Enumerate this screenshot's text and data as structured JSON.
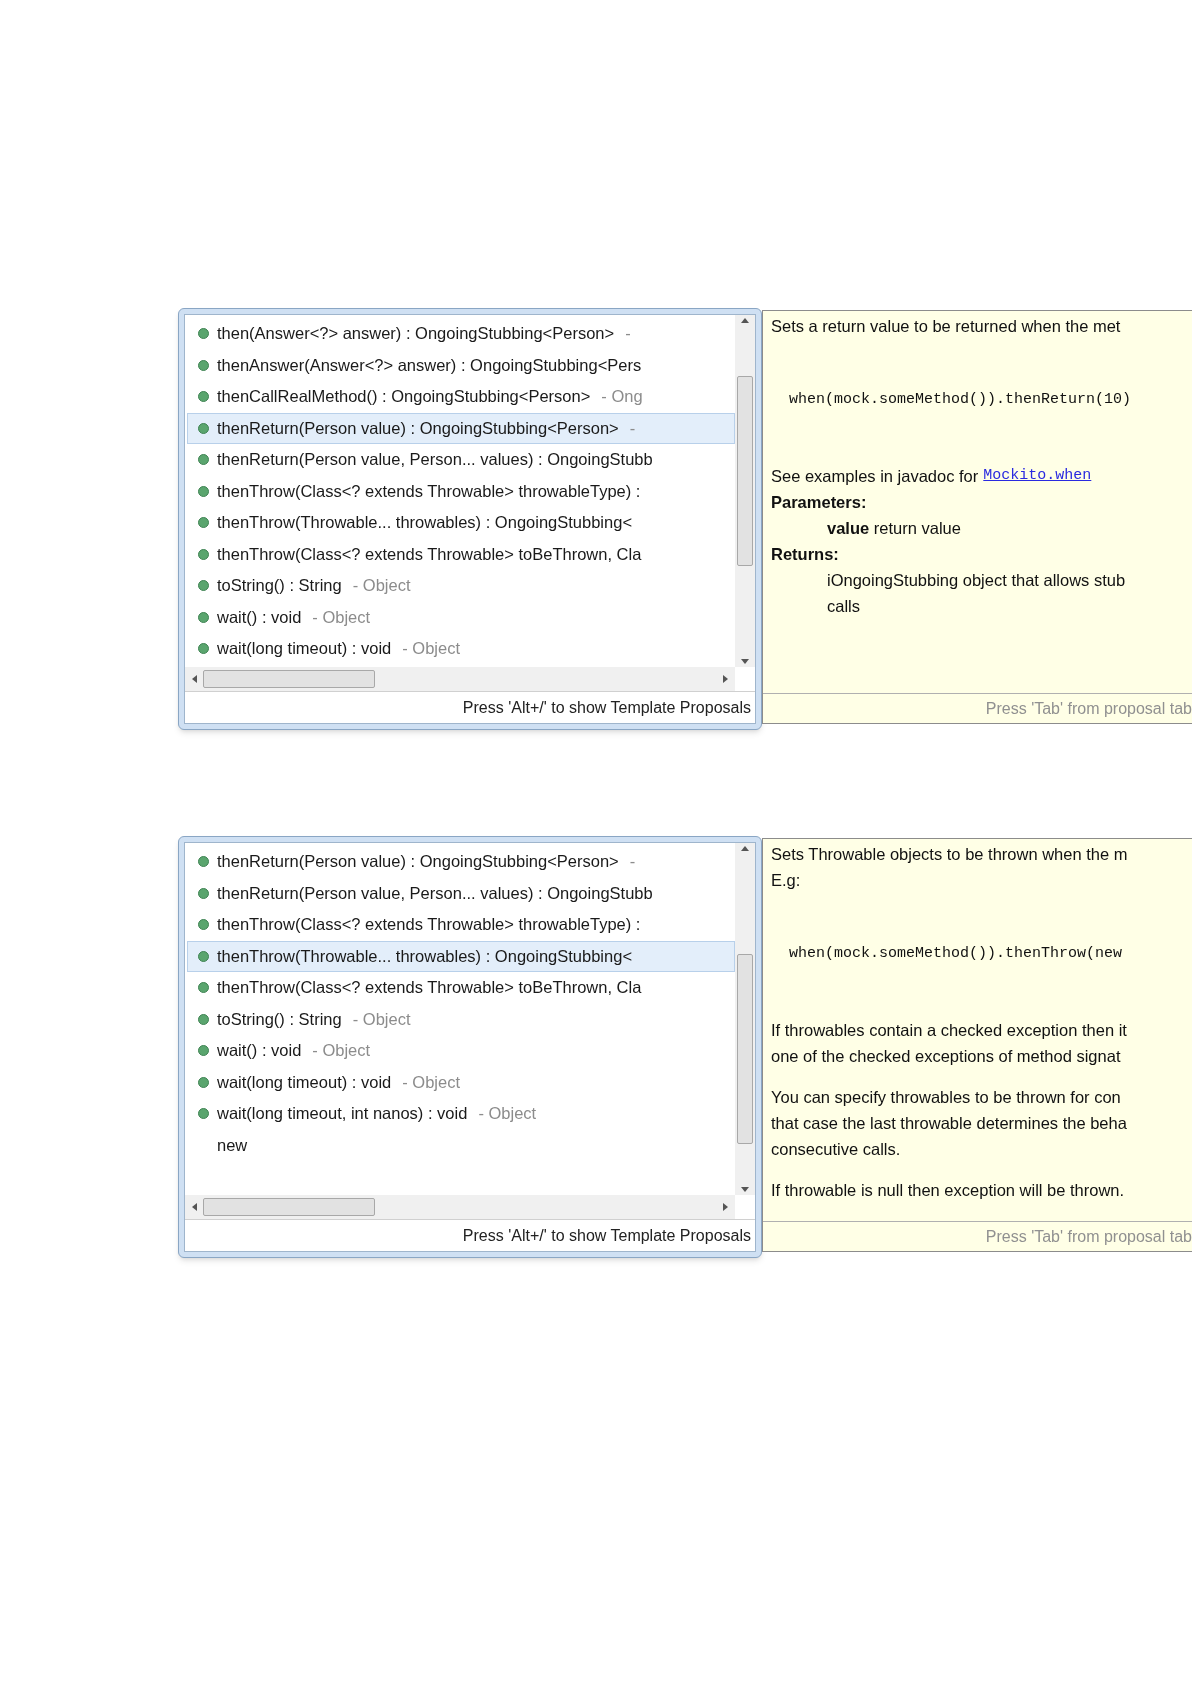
{
  "figures": [
    {
      "proposals": {
        "items": [
          {
            "kind": "method",
            "signature": "then(Answer<?> answer) : OngoingStubbing<Person>",
            "owner": "-",
            "selected": false
          },
          {
            "kind": "method",
            "signature": "thenAnswer(Answer<?> answer) : OngoingStubbing<Pers",
            "selected": false
          },
          {
            "kind": "method",
            "signature": "thenCallRealMethod() : OngoingStubbing<Person>",
            "owner": "- Ong",
            "selected": false
          },
          {
            "kind": "method",
            "signature": "thenReturn(Person value) : OngoingStubbing<Person>",
            "owner": "-",
            "selected": true
          },
          {
            "kind": "method",
            "signature": "thenReturn(Person value, Person... values) : OngoingStubb",
            "selected": false
          },
          {
            "kind": "method",
            "signature": "thenThrow(Class<? extends Throwable> throwableType) :",
            "selected": false
          },
          {
            "kind": "method",
            "signature": "thenThrow(Throwable... throwables) : OngoingStubbing<",
            "selected": false
          },
          {
            "kind": "method",
            "signature": "thenThrow(Class<? extends Throwable> toBeThrown, Cla",
            "selected": false
          },
          {
            "kind": "method",
            "signature": "toString() : String",
            "owner": "- Object",
            "selected": false
          },
          {
            "kind": "method",
            "signature": "wait() : void",
            "owner": "- Object",
            "selected": false
          },
          {
            "kind": "method",
            "signature": "wait(long timeout) : void",
            "owner": "- Object",
            "selected": false
          }
        ],
        "hint": "Press 'Alt+/' to show Template Proposals"
      },
      "doc": {
        "blocks": [
          {
            "kind": "text",
            "lines": [
              "Sets a return value to be returned when the met"
            ]
          },
          {
            "kind": "code",
            "text": "when(mock.someMethod()).thenReturn(10)"
          },
          {
            "kind": "link_text",
            "text": "See examples in javadoc for",
            "link": "Mockito.when"
          },
          {
            "kind": "heading",
            "text": "Parameters:"
          },
          {
            "kind": "indent",
            "lines": [
              "**value** return value"
            ]
          },
          {
            "kind": "heading",
            "text": "Returns:"
          },
          {
            "kind": "indent",
            "lines": [
              "iOngoingStubbing object that allows stub",
              "calls"
            ]
          }
        ],
        "footer": "Press 'Tab' from proposal tab"
      }
    },
    {
      "proposals": {
        "items": [
          {
            "kind": "method",
            "signature": "thenReturn(Person value) : OngoingStubbing<Person>",
            "owner": "-",
            "selected": false
          },
          {
            "kind": "method",
            "signature": "thenReturn(Person value, Person... values) : OngoingStubb",
            "selected": false
          },
          {
            "kind": "method",
            "signature": "thenThrow(Class<? extends Throwable> throwableType) :",
            "selected": false
          },
          {
            "kind": "method",
            "signature": "thenThrow(Throwable... throwables) : OngoingStubbing<",
            "selected": true
          },
          {
            "kind": "method",
            "signature": "thenThrow(Class<? extends Throwable> toBeThrown, Cla",
            "selected": false
          },
          {
            "kind": "method",
            "signature": "toString() : String",
            "owner": "- Object",
            "selected": false
          },
          {
            "kind": "method",
            "signature": "wait() : void",
            "owner": "- Object",
            "selected": false
          },
          {
            "kind": "method",
            "signature": "wait(long timeout) : void",
            "owner": "- Object",
            "selected": false
          },
          {
            "kind": "method",
            "signature": "wait(long timeout, int nanos) : void",
            "owner": "- Object",
            "selected": false
          },
          {
            "kind": "keyword",
            "signature": "new",
            "selected": false
          }
        ],
        "hint": "Press 'Alt+/' to show Template Proposals"
      },
      "doc": {
        "blocks": [
          {
            "kind": "text",
            "lines": [
              "Sets Throwable objects to be thrown when the m",
              "E.g:"
            ]
          },
          {
            "kind": "code",
            "text": "when(mock.someMethod()).thenThrow(new"
          },
          {
            "kind": "text",
            "lines": [
              "If throwables contain a checked exception then it",
              "one of the checked exceptions of method signat"
            ]
          },
          {
            "kind": "text",
            "lines": [
              "You can specify throwables to be thrown for con",
              "that case the last throwable determines the beha",
              "consecutive calls."
            ]
          },
          {
            "kind": "text",
            "lines": [
              "If throwable is null then exception will be thrown."
            ]
          }
        ],
        "footer": "Press 'Tab' from proposal tab"
      }
    }
  ]
}
